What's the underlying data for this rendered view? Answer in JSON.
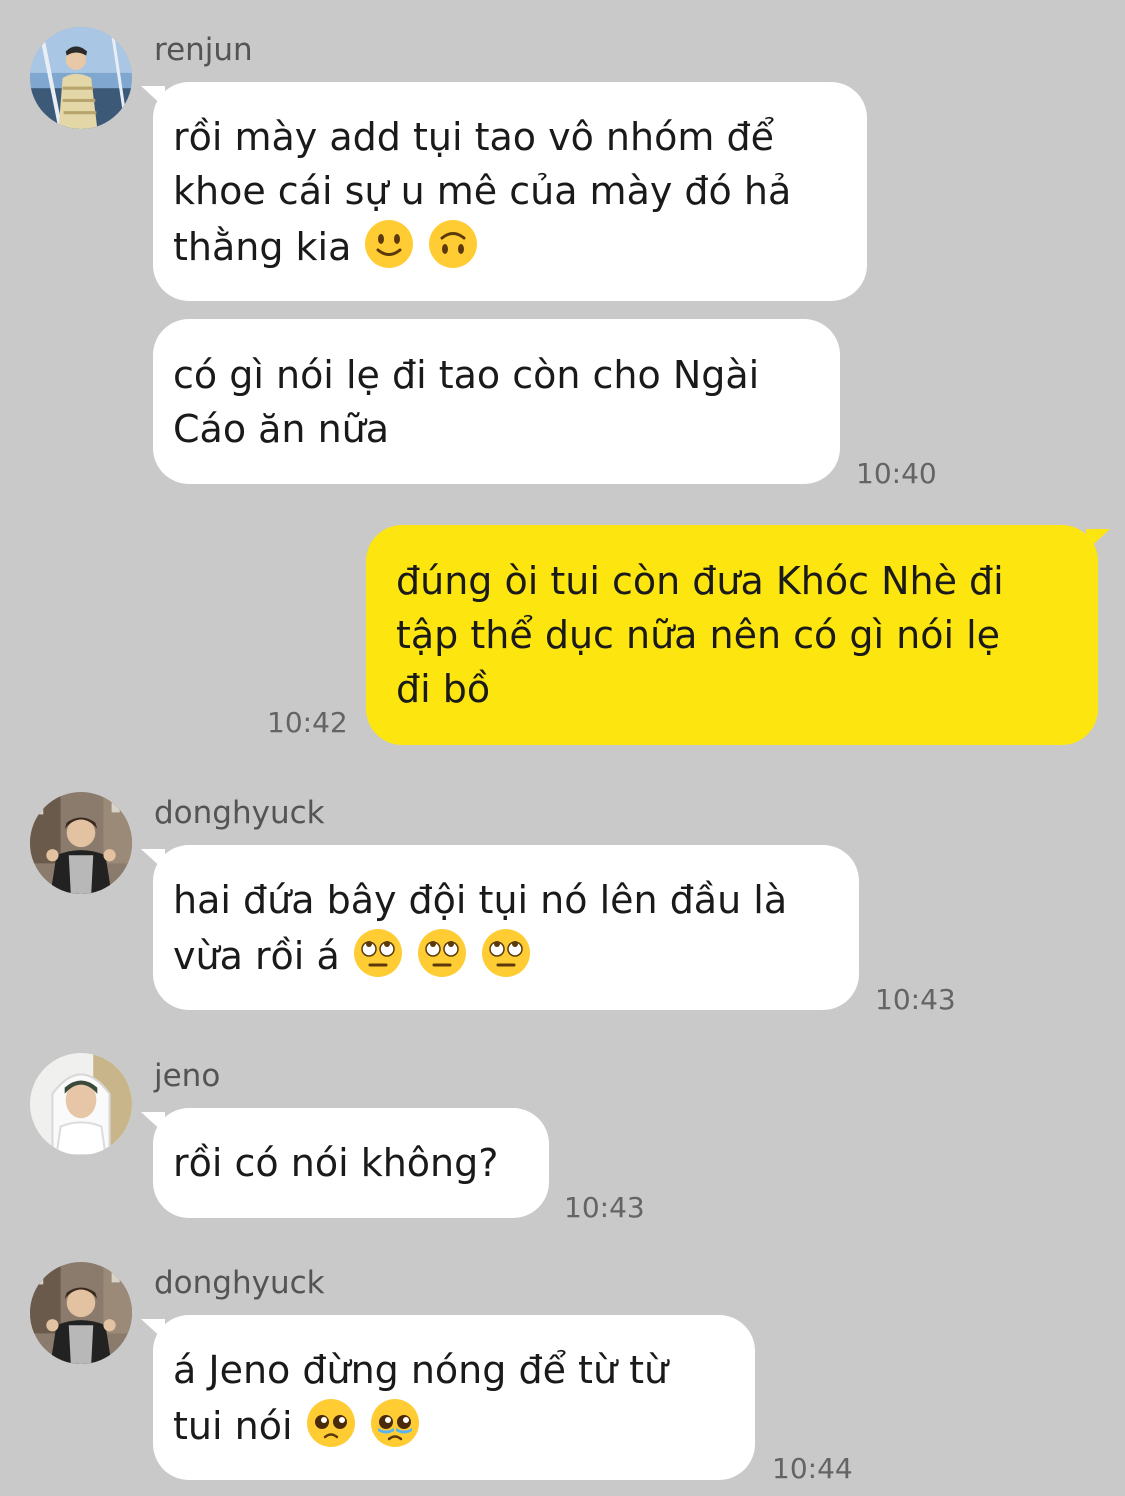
{
  "messages": [
    {
      "sender": "renjun",
      "lines": [
        "rồi mày add tụi tao vô nhóm để",
        "khoe cái sự u mê của mày đó hả",
        "thằng kia"
      ],
      "emojis": [
        "slightly-smiling-face",
        "upside-down-face"
      ]
    },
    {
      "lines": [
        "có gì nói lẹ đi tao còn cho Ngài",
        "Cáo ăn nữa"
      ],
      "time": "10:40"
    },
    {
      "outgoing": true,
      "lines": [
        "đúng òi tui còn đưa Khóc Nhè đi",
        "tập thể dục nữa nên có gì nói lẹ",
        "đi bồ"
      ],
      "time": "10:42"
    },
    {
      "sender": "donghyuck",
      "lines": [
        "hai đứa bây đội tụi nó lên đầu là",
        "vừa rồi á"
      ],
      "emojis": [
        "eye-roll-face",
        "eye-roll-face",
        "eye-roll-face"
      ],
      "time": "10:43"
    },
    {
      "sender": "jeno",
      "lines": [
        "rồi có nói không?"
      ],
      "time": "10:43"
    },
    {
      "sender": "donghyuck",
      "lines": [
        "á Jeno đừng nóng để từ từ",
        "tui nói"
      ],
      "emojis": [
        "pleading-face",
        "pleading-face-tear"
      ],
      "time": "10:44"
    }
  ],
  "colors": {
    "background": "#c9c9c9",
    "incoming_bubble": "#ffffff",
    "outgoing_bubble": "#fde50f",
    "sender_text": "#545454",
    "timestamp_text": "#646464"
  }
}
